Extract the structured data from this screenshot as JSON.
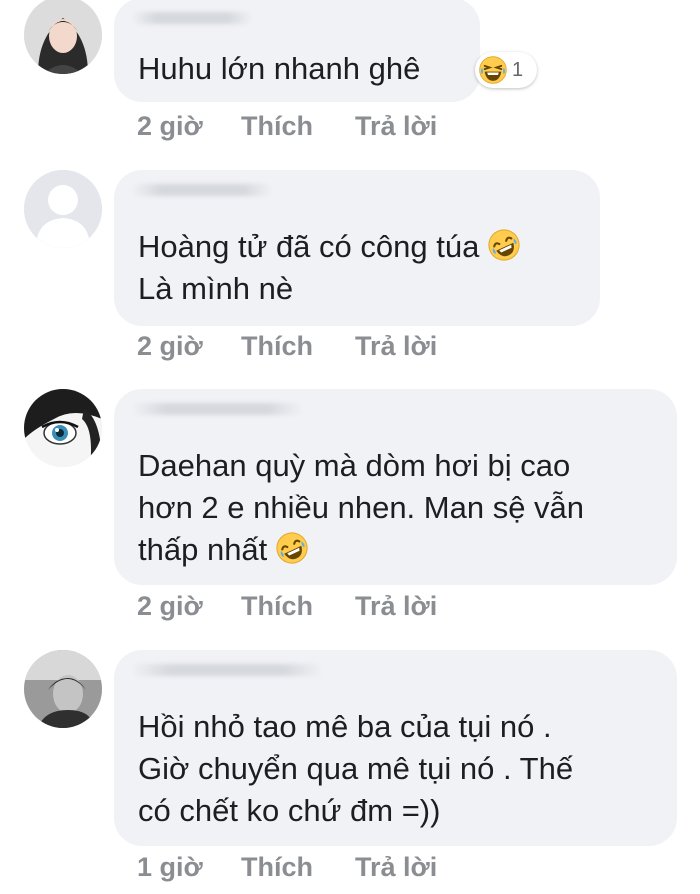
{
  "comments": [
    {
      "text_lines": [
        "Huhu lớn nhanh ghê"
      ],
      "reaction": {
        "icon": "laughing-emoji-icon",
        "count": "1"
      },
      "time": "2 giờ",
      "like_label": "Thích",
      "reply_label": "Trả lời"
    },
    {
      "text_lines": [
        "Hoàng tử đã có công túa",
        "Là mình nè"
      ],
      "inline_emoji": "rofl-emoji-icon",
      "time": "2 giờ",
      "like_label": "Thích",
      "reply_label": "Trả lời"
    },
    {
      "text_lines": [
        "Daehan quỳ mà dòm hơi bị cao",
        "hơn 2 e nhiều nhen. Man sệ vẫn",
        "thấp nhất"
      ],
      "inline_emoji": "rofl-emoji-icon",
      "time": "2 giờ",
      "like_label": "Thích",
      "reply_label": "Trả lời"
    },
    {
      "text_lines": [
        "Hồi nhỏ tao mê ba của tụi nó .",
        "Giờ chuyển qua mê tụi nó . Thế",
        "có chết ko chứ đm =))"
      ],
      "time": "1 giờ",
      "like_label": "Thích",
      "reply_label": "Trả lời"
    }
  ],
  "colors": {
    "bubble": "#f0f2f5",
    "meta_text": "#8a8d91",
    "body_text": "#1c1e21",
    "emoji_yellow": "#ffcc4d"
  }
}
